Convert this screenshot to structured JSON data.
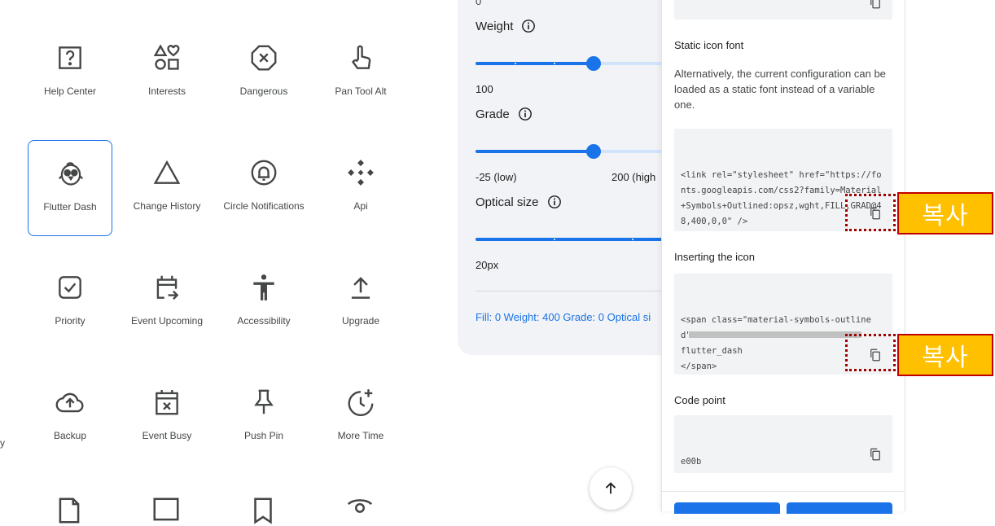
{
  "icons": [
    {
      "label": "Help Center",
      "icon": "help-center-icon"
    },
    {
      "label": "Interests",
      "icon": "interests-icon"
    },
    {
      "label": "Dangerous",
      "icon": "dangerous-icon"
    },
    {
      "label": "Pan Tool Alt",
      "icon": "pan-tool-alt-icon"
    },
    {
      "label": "Flutter Dash",
      "icon": "flutter-dash-icon",
      "selected": true
    },
    {
      "label": "Change History",
      "icon": "change-history-icon"
    },
    {
      "label": "Circle Notifications",
      "icon": "circle-notifications-icon"
    },
    {
      "label": "Api",
      "icon": "api-icon"
    },
    {
      "label": "Priority",
      "icon": "priority-icon"
    },
    {
      "label": "Event Upcoming",
      "icon": "event-upcoming-icon"
    },
    {
      "label": "Accessibility",
      "icon": "accessibility-icon"
    },
    {
      "label": "Upgrade",
      "icon": "upgrade-icon"
    },
    {
      "label": "Backup",
      "icon": "backup-icon"
    },
    {
      "label": "Event Busy",
      "icon": "event-busy-icon"
    },
    {
      "label": "Push Pin",
      "icon": "push-pin-icon"
    },
    {
      "label": "More Time",
      "icon": "more-time-icon"
    }
  ],
  "partial_label": "y",
  "customize": {
    "fill_value": "0",
    "weight": {
      "label": "Weight",
      "value": "100",
      "level": 0.5
    },
    "grade": {
      "label": "Grade",
      "value_low": "-25 (low)",
      "value_high": "200 (high",
      "level": 0.5
    },
    "optical_size": {
      "label": "Optical size",
      "value": "20px",
      "level": 1.0
    },
    "summary": "Fill: 0 Weight: 400 Grade: 0 Optical si"
  },
  "side_panel": {
    "static_font_title": "Static icon font",
    "static_font_text": "Alternatively, the current configuration can be loaded as a static font instead of a variable one.",
    "static_font_code": "<link rel=\"stylesheet\" href=\"https://fonts.googleapis.com/css2?family=Material+Symbols+Outlined:opsz,wght,FILL,GRAD@48,400,0,0\" />",
    "inserting_title": "Inserting the icon",
    "inserting_code": "<span class=\"material-symbols-outlined\">\nflutter_dash\n</span>",
    "code_point_title": "Code point",
    "code_point_value": "e00b"
  },
  "annotations": {
    "copy_tag": "복사"
  },
  "colors": {
    "accent": "#1a73e8",
    "annotation_fill": "#ffc000",
    "annotation_border": "#c00000"
  }
}
